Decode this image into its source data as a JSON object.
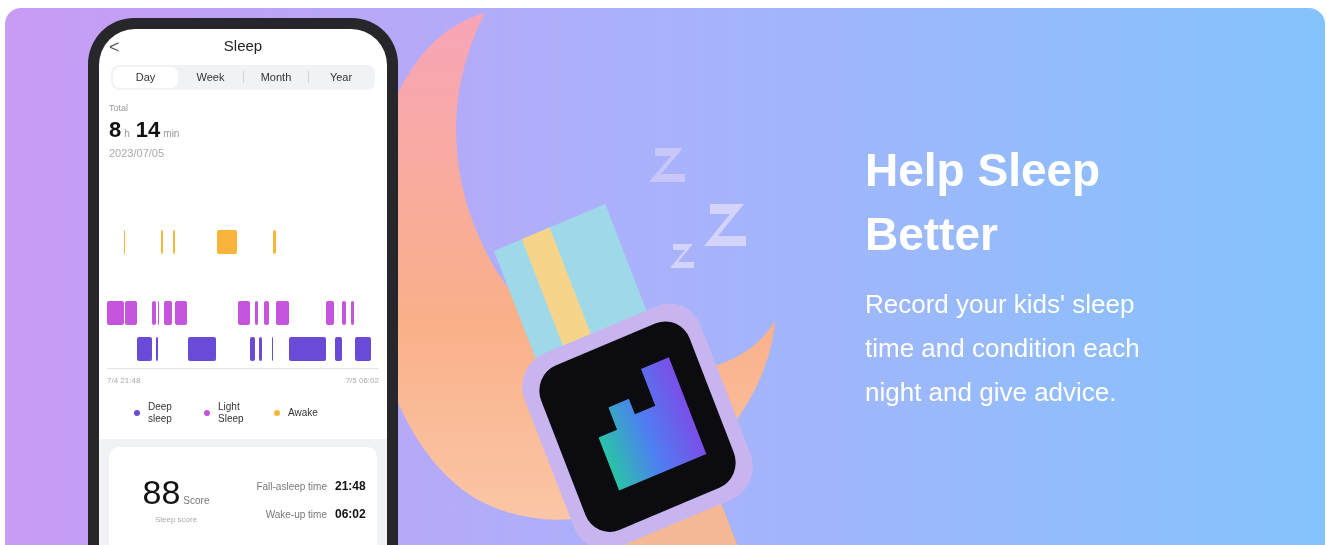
{
  "phone": {
    "title": "Sleep",
    "back_icon": "<",
    "tabs": [
      {
        "label": "Day",
        "selected": true
      },
      {
        "label": "Week",
        "selected": false
      },
      {
        "label": "Month",
        "selected": false
      },
      {
        "label": "Year",
        "selected": false
      }
    ],
    "total_label": "Total",
    "hours": "8",
    "hours_unit": "h",
    "minutes": "14",
    "minutes_unit": "min",
    "date": "2023/07/05",
    "chart_start": "7/4 21:48",
    "chart_end": "7/5 06:02",
    "legend": [
      {
        "label": "Deep sleep",
        "color": "#6a4bd8"
      },
      {
        "label": "Light Sleep",
        "color": "#c455dc"
      },
      {
        "label": "Awake",
        "color": "#f9b53b"
      }
    ],
    "score": "88",
    "score_unit": "Score",
    "score_label": "Sleep score",
    "times": [
      {
        "label": "Fall-asleep time",
        "value": "21:48"
      },
      {
        "label": "Wake-up time",
        "value": "06:02"
      }
    ]
  },
  "headline": "Help Sleep Better",
  "body": "Record your kids' sleep time and condition each night and give advice."
}
